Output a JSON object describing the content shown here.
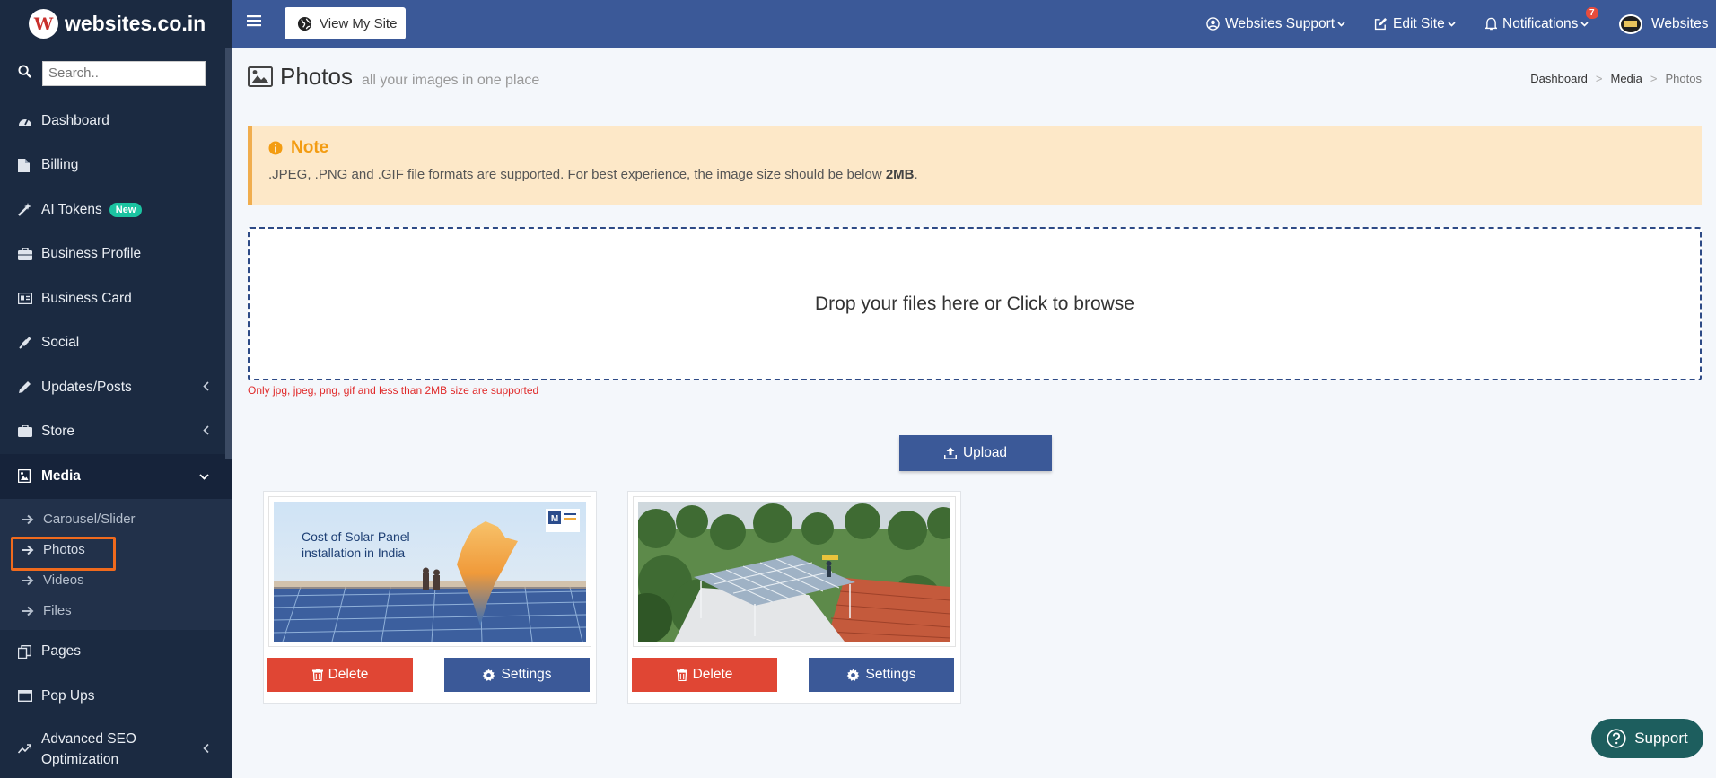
{
  "brand": {
    "name": "websites.co.in",
    "logo_letter": "W"
  },
  "search": {
    "placeholder": "Search.."
  },
  "sidebar": {
    "items": [
      {
        "label": "Dashboard",
        "icon": "dashboard-icon"
      },
      {
        "label": "Billing",
        "icon": "file-icon"
      },
      {
        "label": "AI Tokens",
        "icon": "magic-wand-icon",
        "badge": "New"
      },
      {
        "label": "Business Profile",
        "icon": "briefcase-icon"
      },
      {
        "label": "Business Card",
        "icon": "id-card-icon"
      },
      {
        "label": "Social",
        "icon": "plug-icon"
      },
      {
        "label": "Updates/Posts",
        "icon": "pencil-icon"
      },
      {
        "label": "Store",
        "icon": "store-icon"
      },
      {
        "label": "Media",
        "icon": "image-file-icon"
      },
      {
        "label": "Pages",
        "icon": "copy-icon"
      },
      {
        "label": "Pop Ups",
        "icon": "window-icon"
      },
      {
        "label": "Advanced SEO Optimization",
        "icon": "trend-icon"
      }
    ],
    "media_sub": [
      {
        "label": "Carousel/Slider"
      },
      {
        "label": "Photos"
      },
      {
        "label": "Videos"
      },
      {
        "label": "Files"
      }
    ]
  },
  "topbar": {
    "view_site": "View My Site",
    "support_menu": "Websites Support",
    "edit_site": "Edit Site",
    "notifications": "Notifications",
    "notifications_count": "7",
    "account": "Websites"
  },
  "page": {
    "title": "Photos",
    "subtitle": "all your images in one place",
    "breadcrumb": [
      "Dashboard",
      "Media",
      "Photos"
    ],
    "breadcrumb_sep": ">"
  },
  "note": {
    "title": "Note",
    "text_before": ".JPEG, .PNG and .GIF file formats are supported. For best experience, the image size should be below ",
    "text_bold": "2MB",
    "text_after": "."
  },
  "dropzone": {
    "text": "Drop your files here or Click to browse",
    "warning": "Only jpg, jpeg, png, gif and less than 2MB size are supported"
  },
  "upload_label": "Upload",
  "photos": [
    {
      "caption_line1": "Cost of Solar Panel",
      "caption_line2": "installation in India",
      "delete_label": "Delete",
      "settings_label": "Settings"
    },
    {
      "delete_label": "Delete",
      "settings_label": "Settings"
    }
  ],
  "support_label": "Support",
  "colors": {
    "sidebar_bg": "#1b2a41",
    "topbar_bg": "#3b5998",
    "delete_red": "#e04634",
    "note_bg": "#fde8c8",
    "note_accent": "#f39c12",
    "highlight_orange": "#f06a1d",
    "support_bg": "#1d5e5e"
  }
}
